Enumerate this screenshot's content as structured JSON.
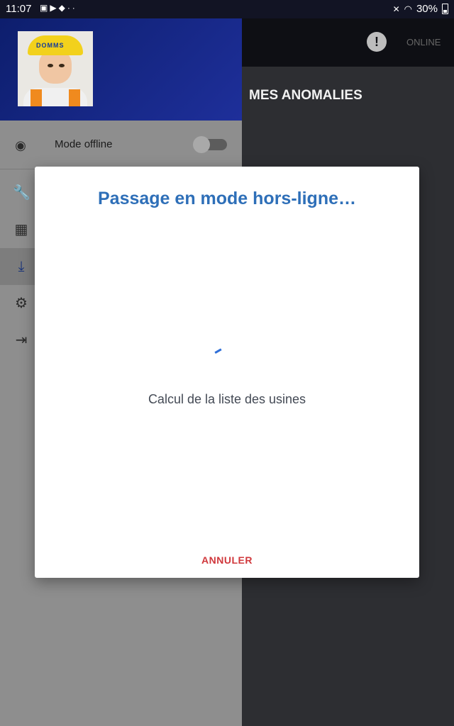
{
  "status_bar": {
    "time": "11:07",
    "battery": "30%",
    "left_icons": [
      "image-icon",
      "youtube-icon",
      "bag-icon",
      "more-dots-icon"
    ],
    "right_icons": [
      "mute-icon",
      "wifi-icon",
      "battery-icon"
    ]
  },
  "app_bar": {
    "connection_status": "ONLINE",
    "alert_icon": "alert-icon"
  },
  "main": {
    "title": "MES ANOMALIES"
  },
  "drawer": {
    "avatar_helmet_text": "DOMMS",
    "offline_toggle": {
      "label": "Mode offline",
      "enabled": false,
      "icon": "antenna-icon"
    },
    "menu_items": [
      {
        "icon": "wrench-icon",
        "active": false
      },
      {
        "icon": "calendar-icon",
        "active": false
      },
      {
        "icon": "download-icon",
        "active": true
      },
      {
        "icon": "settings-icon",
        "active": false
      },
      {
        "icon": "logout-icon",
        "active": false
      }
    ]
  },
  "dialog": {
    "title": "Passage en mode hors-ligne…",
    "message": "Calcul de la liste des usines",
    "cancel_label": "ANNULER"
  },
  "colors": {
    "drawer_header": "#1a2a8a",
    "dialog_title": "#2e6fb8",
    "cancel": "#d0383c",
    "spinner": "#2f6fd8"
  }
}
